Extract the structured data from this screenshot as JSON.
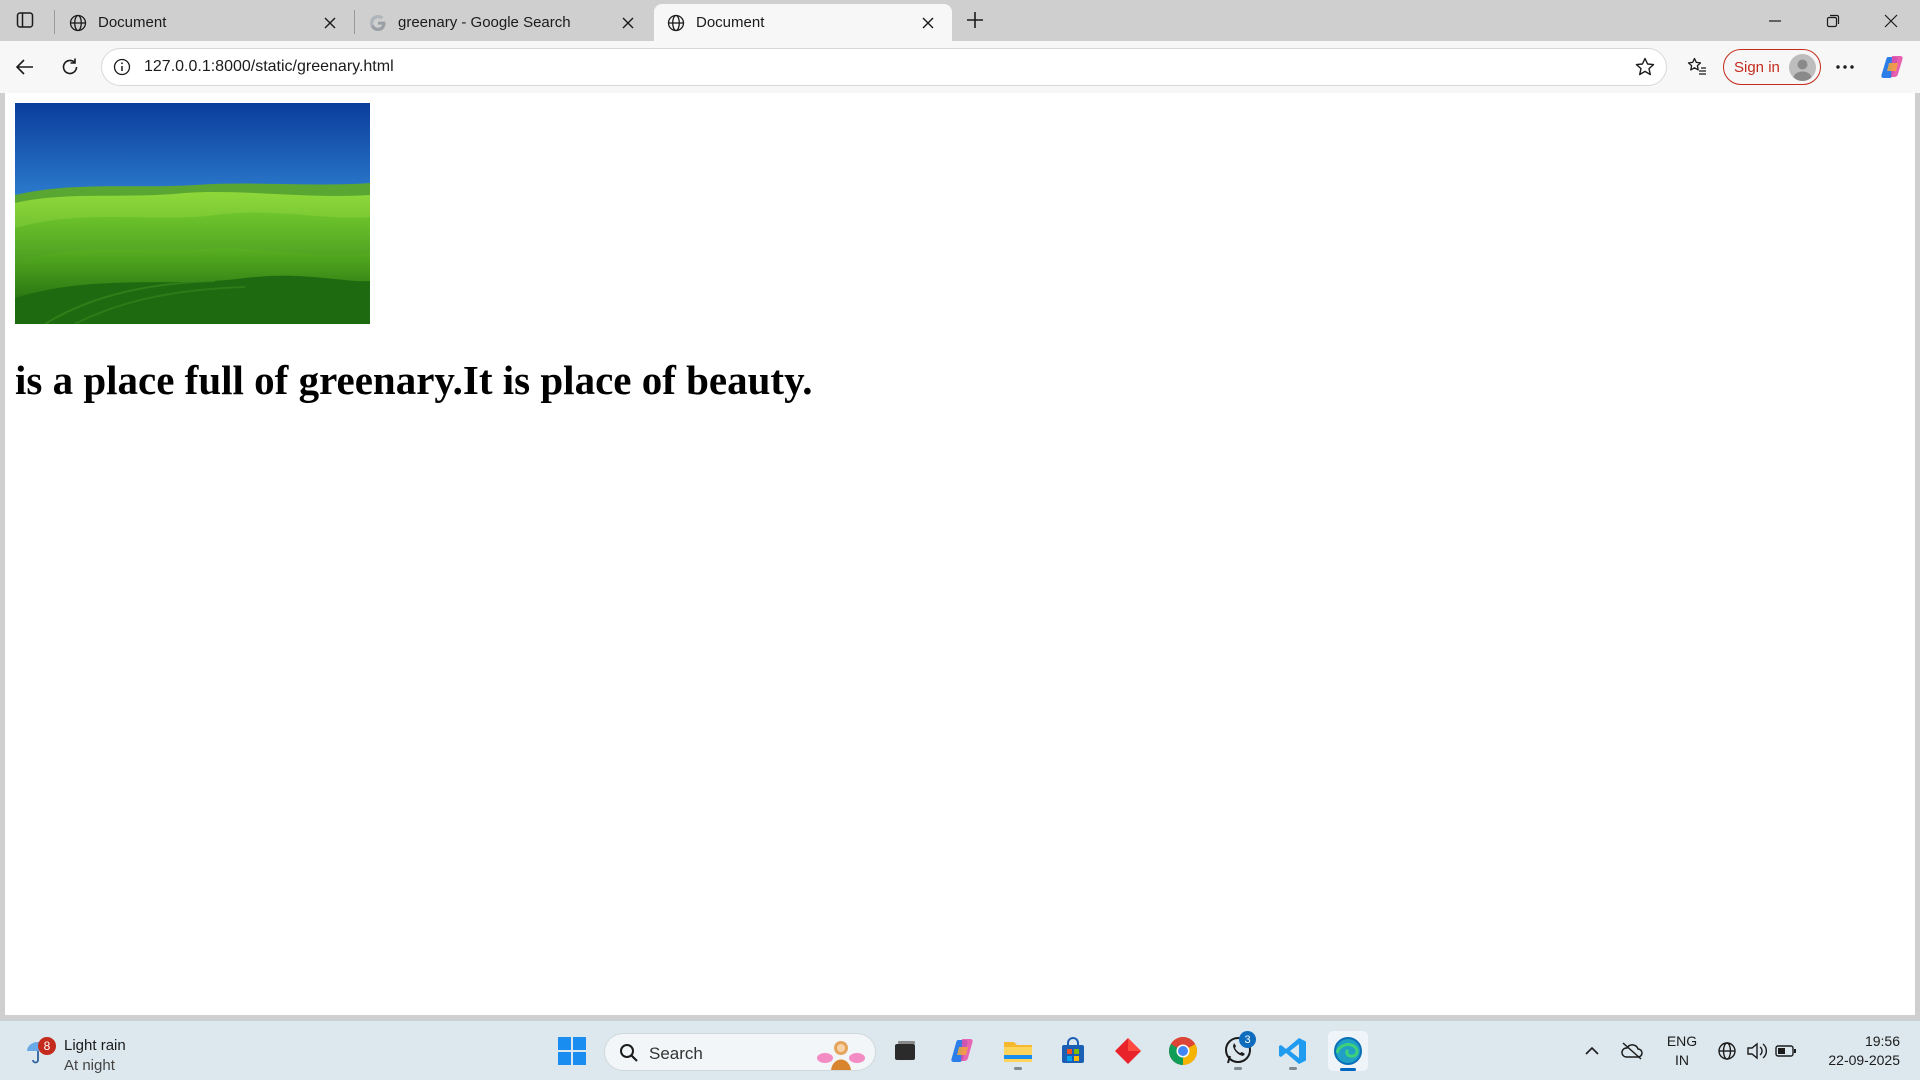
{
  "browser": {
    "tabs": [
      {
        "title": "Document",
        "icon": "globe-icon",
        "active": false
      },
      {
        "title": "greenary - Google Search",
        "icon": "google-icon",
        "active": false
      },
      {
        "title": "Document",
        "icon": "globe-icon",
        "active": true
      }
    ],
    "address_url": "127.0.0.1:8000/static/greenary.html",
    "signin_label": "Sign in"
  },
  "page": {
    "image_icon": "green-hills-landscape",
    "text": "is a place full of greenary.It is place of beauty."
  },
  "taskbar": {
    "weather": {
      "condition": "Light rain",
      "time_of_day": "At night",
      "badge": "8"
    },
    "search_label": "Search",
    "whatsapp_badge": "3",
    "language": {
      "lang": "ENG",
      "region": "IN"
    },
    "clock": {
      "time": "19:56",
      "date": "22-09-2025"
    }
  },
  "colors": {
    "signin_accent": "#c42b1c",
    "taskbar_bg": "#dde8ee",
    "active_indicator": "#0067c0"
  }
}
